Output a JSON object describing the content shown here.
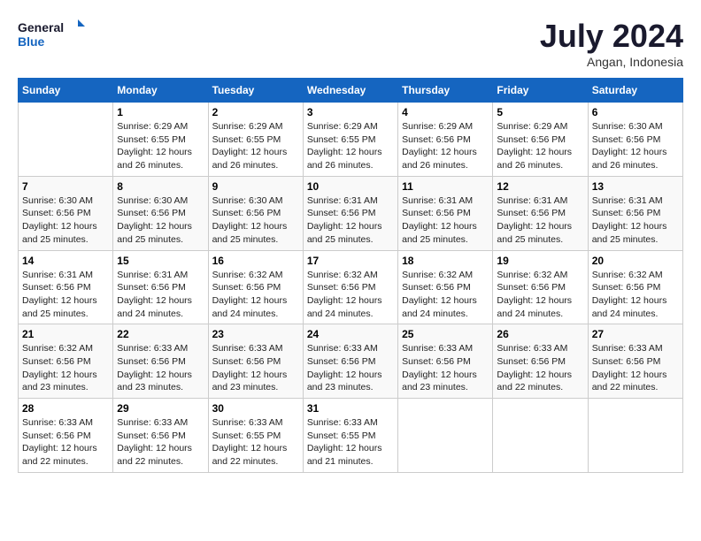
{
  "logo": {
    "line1": "General",
    "line2": "Blue"
  },
  "title": "July 2024",
  "location": "Angan, Indonesia",
  "days_of_week": [
    "Sunday",
    "Monday",
    "Tuesday",
    "Wednesday",
    "Thursday",
    "Friday",
    "Saturday"
  ],
  "weeks": [
    [
      {
        "day": "",
        "info": ""
      },
      {
        "day": "1",
        "info": "Sunrise: 6:29 AM\nSunset: 6:55 PM\nDaylight: 12 hours\nand 26 minutes."
      },
      {
        "day": "2",
        "info": "Sunrise: 6:29 AM\nSunset: 6:55 PM\nDaylight: 12 hours\nand 26 minutes."
      },
      {
        "day": "3",
        "info": "Sunrise: 6:29 AM\nSunset: 6:55 PM\nDaylight: 12 hours\nand 26 minutes."
      },
      {
        "day": "4",
        "info": "Sunrise: 6:29 AM\nSunset: 6:56 PM\nDaylight: 12 hours\nand 26 minutes."
      },
      {
        "day": "5",
        "info": "Sunrise: 6:29 AM\nSunset: 6:56 PM\nDaylight: 12 hours\nand 26 minutes."
      },
      {
        "day": "6",
        "info": "Sunrise: 6:30 AM\nSunset: 6:56 PM\nDaylight: 12 hours\nand 26 minutes."
      }
    ],
    [
      {
        "day": "7",
        "info": "Sunrise: 6:30 AM\nSunset: 6:56 PM\nDaylight: 12 hours\nand 25 minutes."
      },
      {
        "day": "8",
        "info": "Sunrise: 6:30 AM\nSunset: 6:56 PM\nDaylight: 12 hours\nand 25 minutes."
      },
      {
        "day": "9",
        "info": "Sunrise: 6:30 AM\nSunset: 6:56 PM\nDaylight: 12 hours\nand 25 minutes."
      },
      {
        "day": "10",
        "info": "Sunrise: 6:31 AM\nSunset: 6:56 PM\nDaylight: 12 hours\nand 25 minutes."
      },
      {
        "day": "11",
        "info": "Sunrise: 6:31 AM\nSunset: 6:56 PM\nDaylight: 12 hours\nand 25 minutes."
      },
      {
        "day": "12",
        "info": "Sunrise: 6:31 AM\nSunset: 6:56 PM\nDaylight: 12 hours\nand 25 minutes."
      },
      {
        "day": "13",
        "info": "Sunrise: 6:31 AM\nSunset: 6:56 PM\nDaylight: 12 hours\nand 25 minutes."
      }
    ],
    [
      {
        "day": "14",
        "info": "Sunrise: 6:31 AM\nSunset: 6:56 PM\nDaylight: 12 hours\nand 25 minutes."
      },
      {
        "day": "15",
        "info": "Sunrise: 6:31 AM\nSunset: 6:56 PM\nDaylight: 12 hours\nand 24 minutes."
      },
      {
        "day": "16",
        "info": "Sunrise: 6:32 AM\nSunset: 6:56 PM\nDaylight: 12 hours\nand 24 minutes."
      },
      {
        "day": "17",
        "info": "Sunrise: 6:32 AM\nSunset: 6:56 PM\nDaylight: 12 hours\nand 24 minutes."
      },
      {
        "day": "18",
        "info": "Sunrise: 6:32 AM\nSunset: 6:56 PM\nDaylight: 12 hours\nand 24 minutes."
      },
      {
        "day": "19",
        "info": "Sunrise: 6:32 AM\nSunset: 6:56 PM\nDaylight: 12 hours\nand 24 minutes."
      },
      {
        "day": "20",
        "info": "Sunrise: 6:32 AM\nSunset: 6:56 PM\nDaylight: 12 hours\nand 24 minutes."
      }
    ],
    [
      {
        "day": "21",
        "info": "Sunrise: 6:32 AM\nSunset: 6:56 PM\nDaylight: 12 hours\nand 23 minutes."
      },
      {
        "day": "22",
        "info": "Sunrise: 6:33 AM\nSunset: 6:56 PM\nDaylight: 12 hours\nand 23 minutes."
      },
      {
        "day": "23",
        "info": "Sunrise: 6:33 AM\nSunset: 6:56 PM\nDaylight: 12 hours\nand 23 minutes."
      },
      {
        "day": "24",
        "info": "Sunrise: 6:33 AM\nSunset: 6:56 PM\nDaylight: 12 hours\nand 23 minutes."
      },
      {
        "day": "25",
        "info": "Sunrise: 6:33 AM\nSunset: 6:56 PM\nDaylight: 12 hours\nand 23 minutes."
      },
      {
        "day": "26",
        "info": "Sunrise: 6:33 AM\nSunset: 6:56 PM\nDaylight: 12 hours\nand 22 minutes."
      },
      {
        "day": "27",
        "info": "Sunrise: 6:33 AM\nSunset: 6:56 PM\nDaylight: 12 hours\nand 22 minutes."
      }
    ],
    [
      {
        "day": "28",
        "info": "Sunrise: 6:33 AM\nSunset: 6:56 PM\nDaylight: 12 hours\nand 22 minutes."
      },
      {
        "day": "29",
        "info": "Sunrise: 6:33 AM\nSunset: 6:56 PM\nDaylight: 12 hours\nand 22 minutes."
      },
      {
        "day": "30",
        "info": "Sunrise: 6:33 AM\nSunset: 6:55 PM\nDaylight: 12 hours\nand 22 minutes."
      },
      {
        "day": "31",
        "info": "Sunrise: 6:33 AM\nSunset: 6:55 PM\nDaylight: 12 hours\nand 21 minutes."
      },
      {
        "day": "",
        "info": ""
      },
      {
        "day": "",
        "info": ""
      },
      {
        "day": "",
        "info": ""
      }
    ]
  ]
}
